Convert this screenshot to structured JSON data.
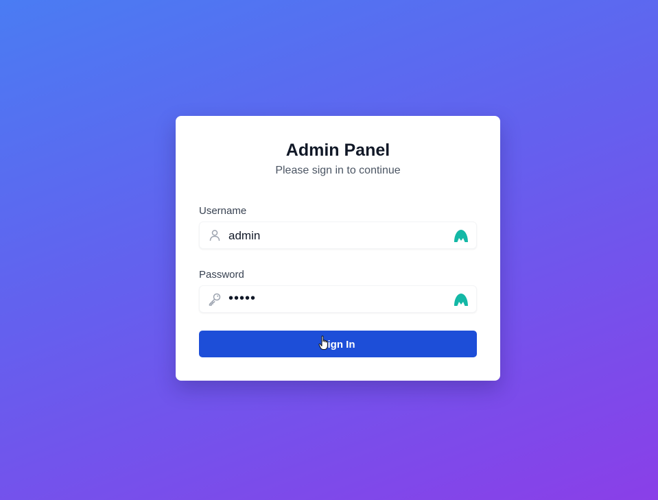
{
  "login": {
    "title": "Admin Panel",
    "subtitle": "Please sign in to continue",
    "username": {
      "label": "Username",
      "value": "admin",
      "lead_icon": "user-icon",
      "extension_icon": "password-manager-icon"
    },
    "password": {
      "label": "Password",
      "value": "•••••",
      "lead_icon": "key-icon",
      "extension_icon": "password-manager-icon"
    },
    "submit_label": "Sign In"
  },
  "colors": {
    "background_start": "#4a7cf3",
    "background_end": "#8a3fe8",
    "button": "#1d4ed8",
    "extension_icon": "#14b8a6"
  }
}
